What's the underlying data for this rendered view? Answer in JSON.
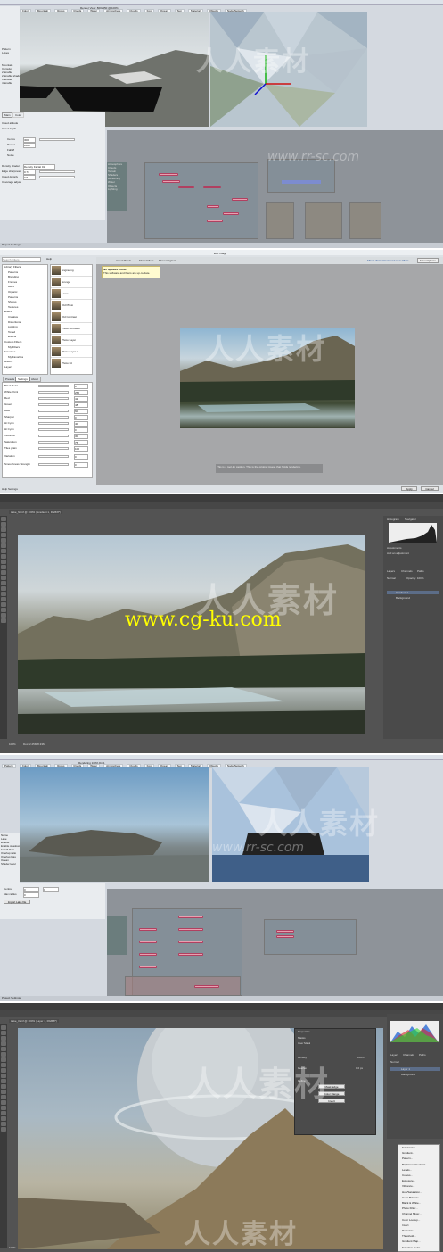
{
  "panel1": {
    "toolbar": [
      "Pattern",
      "Color",
      "Mountain",
      "Rocks",
      "Roads",
      "Water",
      "Atmosphere",
      "Clouds",
      "Fog",
      "Ocean",
      "Sun",
      "Material",
      "Objects",
      "Node Network"
    ],
    "render_title": "Render View: 800x450 @ 100%",
    "left_items": [
      "Pattern",
      "Lakes"
    ],
    "left_list": [
      "Mountain",
      "Cumulus",
      "2 Enable",
      "2 Enable shadows",
      "3 Enable",
      "4 Enable"
    ],
    "tabs": [
      "Main",
      "Color"
    ],
    "cloud_params": [
      "Cloud altitude",
      "Cloud depth",
      "Centre",
      "Radius",
      "Falloff",
      "Noise",
      "Density shader",
      "Edge sharpness",
      "Cloud density",
      "Coverage adjust"
    ],
    "density_shader_value": "Density fractal 01",
    "values": [
      "300",
      "1000",
      "0.77",
      "0.5"
    ],
    "node_groups": [
      "Atmosphere",
      "Clouds",
      "Terrain",
      "Shaders",
      "Rendering",
      "Water",
      "Objects",
      "Lighting"
    ],
    "status": "Project Settings"
  },
  "panel2": {
    "menu": [
      "File",
      "View",
      "Filter",
      "Tools",
      "Help"
    ],
    "search": "Search Filters",
    "title": "Edit Image",
    "library": [
      "Library Filters",
      "Patterns",
      "Branding",
      "Frames",
      "Blurs",
      "Organic",
      "Patterns",
      "Shares",
      "Textures",
      "Effects",
      "Creative",
      "Distortions",
      "Lighting",
      "Toned",
      "Effects",
      "Custom Filters",
      "My Filters",
      "Favorites",
      "My Favorites",
      "History",
      "Layers"
    ],
    "presets": [
      "Engraving",
      "Grunge",
      "Lomo",
      "Old Photo",
      "Old Contrast",
      "Photo Emulsion",
      "Photo Layer",
      "Photo Layer 2",
      "Photo Kit"
    ],
    "tabs": [
      "Presets",
      "Settings",
      "About"
    ],
    "settings": [
      "Black Point",
      "White Point",
      "Red",
      "Green",
      "Blue",
      "Sharpen",
      "Hi Cyan",
      "Hi Cyan",
      "Vibrance",
      "Saturation",
      "Tiles grain",
      "Variation",
      "Smoothness Strength"
    ],
    "setting_values": [
      "0",
      "255",
      "42",
      "48",
      "60",
      "0",
      "40",
      "0",
      "30",
      "75",
      "100",
      "0",
      "0"
    ],
    "notice_title": "No updates found",
    "notice_body": "This software and filters are up-to-date.",
    "options": [
      "Actual Pixels",
      "Show Filters",
      "Show Original"
    ],
    "top_links": "Filter Library Download more filters",
    "filter_options": "Filter Options",
    "caption": "This is a tool-tip caption. This is the original image that holds rendering.",
    "buttons": [
      "Apply",
      "Cancel"
    ],
    "status": "Help Settings"
  },
  "panel3": {
    "menu": [
      "File",
      "Edit",
      "Image",
      "Layer",
      "Type",
      "Select",
      "Filter",
      "3D",
      "View",
      "Window",
      "Help"
    ],
    "doc_tab": "Lake_Nil.tif @ 100% (Gradient 1, RGB/8*)",
    "url": "www.cg-ku.com",
    "panels": [
      "Histogram",
      "Navigator",
      "Adjustments",
      "Add an adjustment",
      "Layers",
      "Channels",
      "Paths",
      "Normal",
      "Opacity: 100%",
      "Lock",
      "Fill: 100%",
      "Gradient 1",
      "Background"
    ],
    "status": "100%",
    "doc_info": "Doc: 2.25M/8.33M"
  },
  "panel4": {
    "toolbar": [
      "Pattern",
      "Color",
      "Mountain",
      "Rocks",
      "Roads",
      "Water",
      "Atmosphere",
      "Clouds",
      "Fog",
      "Ocean",
      "Sun",
      "Material",
      "Objects",
      "Node Network"
    ],
    "render_title": "Rendering 100% Dn.1",
    "left": [
      "Name",
      "Lake",
      "Enable",
      "Enable shadows",
      "Falloff Rad",
      "Overlap ratio",
      "Overlap bias",
      "Ocean",
      "Shader level"
    ],
    "params": [
      "Centre",
      "Max radius",
      "Import Lake file"
    ],
    "values": [
      "0",
      "0",
      "0"
    ],
    "status": "Project Settings"
  },
  "panel5": {
    "menu": [
      "File",
      "Edit",
      "Image",
      "Layer",
      "Type",
      "Select",
      "Filter",
      "3D",
      "View",
      "Window",
      "Help"
    ],
    "doc_tab": "Lake_02.tif @ 100% (Layer 1, RGB/8*)",
    "properties": [
      "Properties",
      "Masks",
      "User Mask",
      "Density",
      "Feather",
      "Refine",
      "Mask Edge",
      "Color Range",
      "Invert"
    ],
    "density": "100%",
    "feather": "0.0 px",
    "layers": [
      "Layers",
      "Channels",
      "Paths",
      "Normal",
      "Opacity",
      "Layer 1",
      "Background"
    ],
    "context_menu": [
      "Solid Color...",
      "Gradient...",
      "Pattern...",
      "Brightness/Contrast...",
      "Levels...",
      "Curves...",
      "Exposure...",
      "Vibrance...",
      "Hue/Saturation...",
      "Color Balance...",
      "Black & White...",
      "Photo Filter...",
      "Channel Mixer...",
      "Color Lookup...",
      "Invert",
      "Posterize...",
      "Threshold...",
      "Gradient Map...",
      "Selective Color..."
    ],
    "status": "100%"
  },
  "watermark": {
    "cn": "人人素材",
    "en": "www.rr-sc.com"
  },
  "colors": {
    "ps_dark": "#535353",
    "ps_darker": "#3b3b3b",
    "terragen_bg": "#d4d9e0",
    "node_pink": "#e8a0b0",
    "accent_yellow": "#ffff00"
  }
}
